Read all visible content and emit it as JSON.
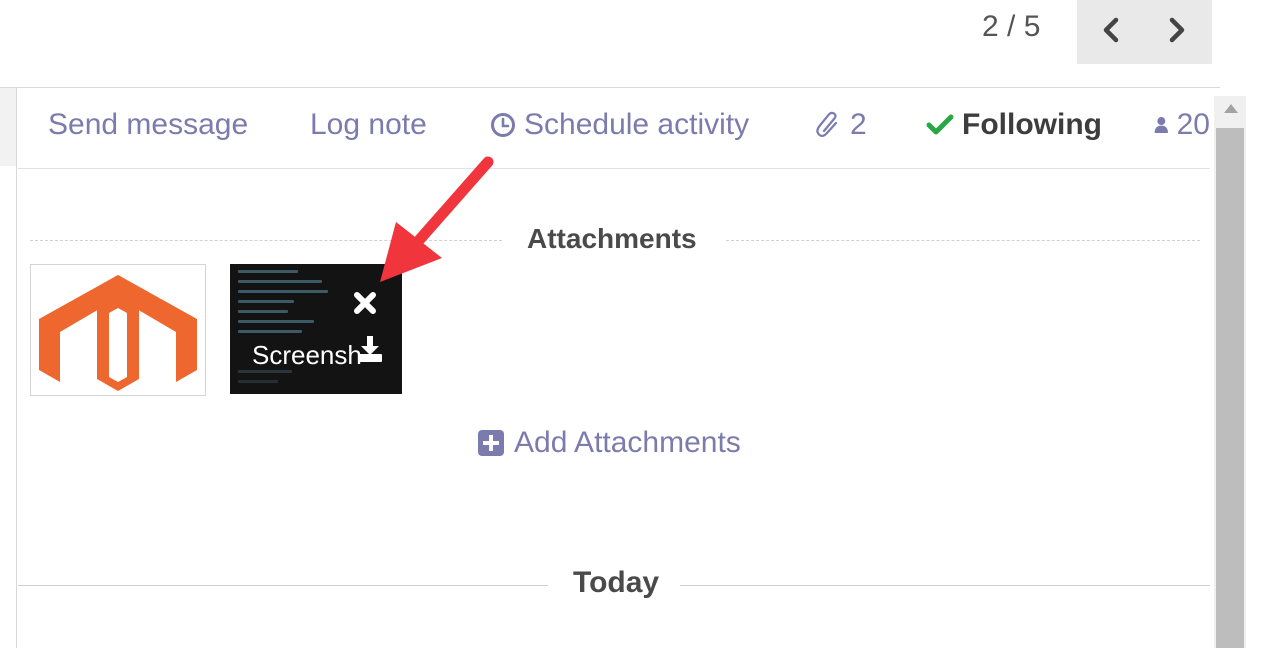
{
  "pager": {
    "counter": "2 / 5"
  },
  "toolbar": {
    "send_message": "Send message",
    "log_note": "Log note",
    "schedule_activity": "Schedule activity",
    "attachment_count": "2",
    "following": "Following",
    "followers_count": "20"
  },
  "attachments": {
    "section_title": "Attachments",
    "items": [
      {
        "name": "",
        "thumb": "magento-logo"
      },
      {
        "name": "Screensh",
        "thumb": "code-screenshot"
      }
    ],
    "add_label": "Add Attachments"
  },
  "thread": {
    "date_separator": "Today"
  },
  "colors": {
    "link": "#7c7bad",
    "following_check": "#28a745",
    "magento_orange": "#ee672f",
    "annotation_red": "#f0353d"
  }
}
